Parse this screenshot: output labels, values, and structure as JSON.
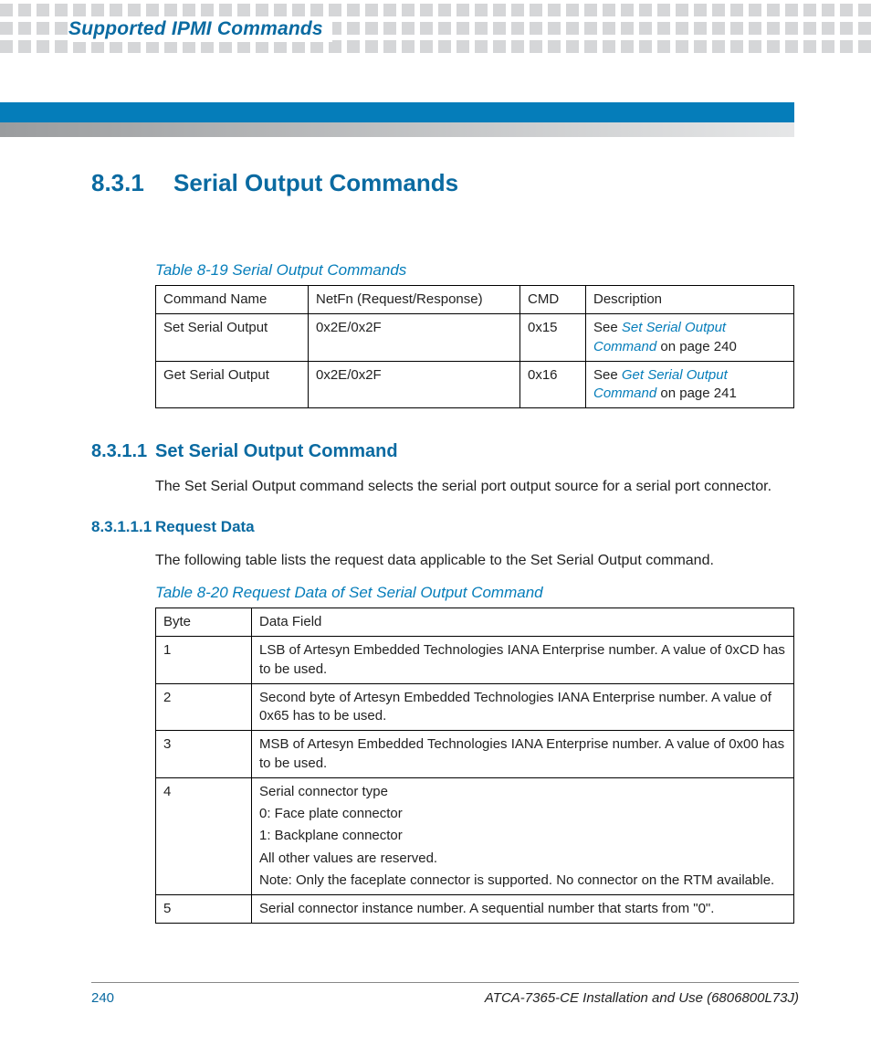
{
  "header": {
    "running_head": "Supported IPMI Commands"
  },
  "section_8_3_1": {
    "number": "8.3.1",
    "title": "Serial Output Commands"
  },
  "table_8_19": {
    "caption": "Table 8-19 Serial Output Commands",
    "headers": [
      "Command Name",
      "NetFn (Request/Response)",
      "CMD",
      "Description"
    ],
    "rows": [
      {
        "name": "Set Serial Output",
        "netfn": "0x2E/0x2F",
        "cmd": "0x15",
        "desc_prefix": "See ",
        "desc_link": "Set Serial Output Command",
        "desc_suffix": " on page 240"
      },
      {
        "name": "Get Serial Output",
        "netfn": "0x2E/0x2F",
        "cmd": "0x16",
        "desc_prefix": "See ",
        "desc_link": "Get Serial Output Command",
        "desc_suffix": " on page 241"
      }
    ]
  },
  "section_8_3_1_1": {
    "number": "8.3.1.1",
    "title": "Set Serial Output Command",
    "body": "The Set Serial Output command selects the serial port output source for a serial port connector."
  },
  "section_8_3_1_1_1": {
    "number": "8.3.1.1.1",
    "title": "Request Data",
    "body": "The following table lists the request data applicable to the Set Serial Output command."
  },
  "table_8_20": {
    "caption": "Table 8-20 Request Data of Set Serial Output Command",
    "headers": [
      "Byte",
      "Data Field"
    ],
    "rows": [
      {
        "byte": "1",
        "field": [
          "LSB of Artesyn Embedded Technologies IANA Enterprise number. A value of 0xCD has to be used."
        ]
      },
      {
        "byte": "2",
        "field": [
          "Second byte of Artesyn Embedded Technologies IANA Enterprise number. A value of 0x65 has to be used."
        ]
      },
      {
        "byte": "3",
        "field": [
          "MSB of Artesyn Embedded Technologies IANA Enterprise number. A value of 0x00 has to be used."
        ]
      },
      {
        "byte": "4",
        "field": [
          "Serial connector type",
          "0: Face plate connector",
          "1: Backplane connector",
          "All other values are reserved.",
          "Note: Only the faceplate connector is supported. No connector on the RTM available."
        ]
      },
      {
        "byte": "5",
        "field": [
          "Serial connector instance number. A sequential number that starts from \"0\"."
        ]
      }
    ]
  },
  "footer": {
    "page": "240",
    "doc": "ATCA-7365-CE Installation and Use (6806800L73J)"
  }
}
